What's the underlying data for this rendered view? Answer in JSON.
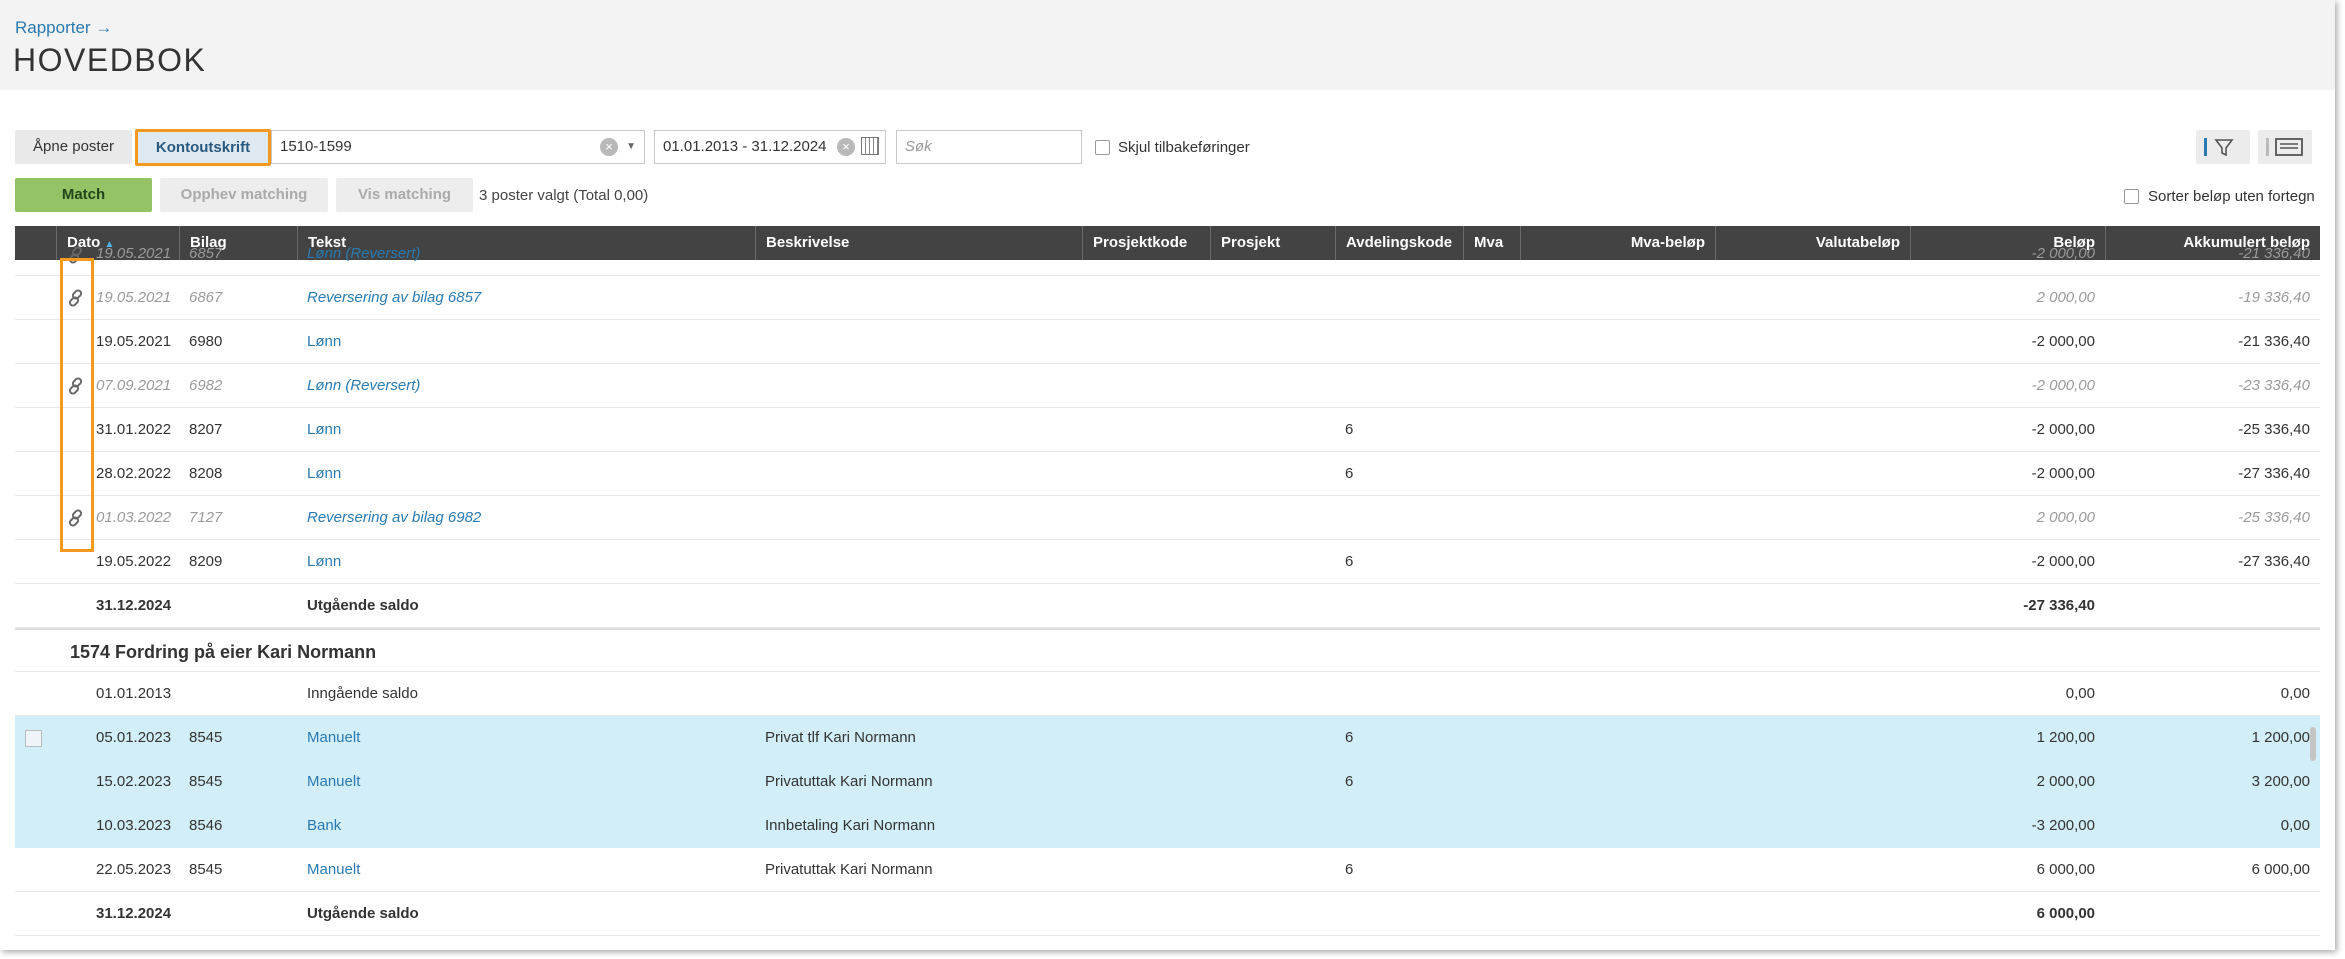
{
  "breadcrumb": "Rapporter →",
  "page_title": "HOVEDBOK",
  "toolbar": {
    "open_items_label": "Åpne poster",
    "statement_label": "Kontoutskrift",
    "account_range": "1510-1599",
    "date_range": "01.01.2013 - 31.12.2024",
    "search_placeholder": "Søk",
    "hide_reversals_label": "Skjul tilbakeføringer",
    "match_label": "Match",
    "unmatch_label": "Opphev matching",
    "show_matching_label": "Vis matching",
    "selection_info": "3 poster valgt (Total 0,00)",
    "sort_unsigned_label": "Sorter beløp uten fortegn"
  },
  "columns": {
    "dato": "Dato",
    "bilag": "Bilag",
    "tekst": "Tekst",
    "beskrivelse": "Beskrivelse",
    "prosjektkode": "Prosjektkode",
    "prosjekt": "Prosjekt",
    "avdelingskode": "Avdelingskode",
    "mva": "Mva",
    "mva_belop": "Mva-beløp",
    "valutabelop": "Valutabeløp",
    "belop": "Beløp",
    "akkumulert": "Akkumulert beløp"
  },
  "section1_rows": [
    {
      "dato": "19.05.2021",
      "bilag": "6857",
      "tekst": "Lønn (Reversert)",
      "avd": "",
      "belop": "-2 000,00",
      "akk": "-21 336,40"
    },
    {
      "dato": "19.05.2021",
      "bilag": "6867",
      "tekst": "Reversering av bilag 6857",
      "avd": "",
      "belop": "2 000,00",
      "akk": "-19 336,40"
    },
    {
      "dato": "19.05.2021",
      "bilag": "6980",
      "tekst": "Lønn",
      "avd": "",
      "belop": "-2 000,00",
      "akk": "-21 336,40"
    },
    {
      "dato": "07.09.2021",
      "bilag": "6982",
      "tekst": "Lønn (Reversert)",
      "avd": "",
      "belop": "-2 000,00",
      "akk": "-23 336,40"
    },
    {
      "dato": "31.01.2022",
      "bilag": "8207",
      "tekst": "Lønn",
      "avd": "6",
      "belop": "-2 000,00",
      "akk": "-25 336,40"
    },
    {
      "dato": "28.02.2022",
      "bilag": "8208",
      "tekst": "Lønn",
      "avd": "6",
      "belop": "-2 000,00",
      "akk": "-27 336,40"
    },
    {
      "dato": "01.03.2022",
      "bilag": "7127",
      "tekst": "Reversering av bilag 6982",
      "avd": "",
      "belop": "2 000,00",
      "akk": "-25 336,40"
    },
    {
      "dato": "19.05.2022",
      "bilag": "8209",
      "tekst": "Lønn",
      "avd": "6",
      "belop": "-2 000,00",
      "akk": "-27 336,40"
    }
  ],
  "section1_total": {
    "dato": "31.12.2024",
    "tekst": "Utgående saldo",
    "belop": "-27 336,40"
  },
  "group2_title": "1574 Fordring på eier Kari Normann",
  "section2_opening": {
    "dato": "01.01.2013",
    "tekst": "Inngående saldo",
    "belop": "0,00",
    "akk": "0,00"
  },
  "section2_rows": [
    {
      "dato": "05.01.2023",
      "bilag": "8545",
      "tekst": "Manuelt",
      "besk": "Privat tlf Kari Normann",
      "avd": "6",
      "belop": "1 200,00",
      "akk": "1 200,00"
    },
    {
      "dato": "15.02.2023",
      "bilag": "8545",
      "tekst": "Manuelt",
      "besk": "Privatuttak Kari Normann",
      "avd": "6",
      "belop": "2 000,00",
      "akk": "3 200,00"
    },
    {
      "dato": "10.03.2023",
      "bilag": "8546",
      "tekst": "Bank",
      "besk": "Innbetaling Kari Normann",
      "avd": "",
      "belop": "-3 200,00",
      "akk": "0,00"
    },
    {
      "dato": "22.05.2023",
      "bilag": "8545",
      "tekst": "Manuelt",
      "besk": "Privatuttak Kari Normann",
      "avd": "6",
      "belop": "6 000,00",
      "akk": "6 000,00"
    }
  ],
  "section2_total": {
    "dato": "31.12.2024",
    "tekst": "Utgående saldo",
    "belop": "6 000,00"
  },
  "colors": {
    "accent_orange": "#f39a1e",
    "link_blue": "#2a7ab0",
    "match_green": "#94c365",
    "header_dark": "#434343",
    "selected_row": "#d2eef8"
  }
}
